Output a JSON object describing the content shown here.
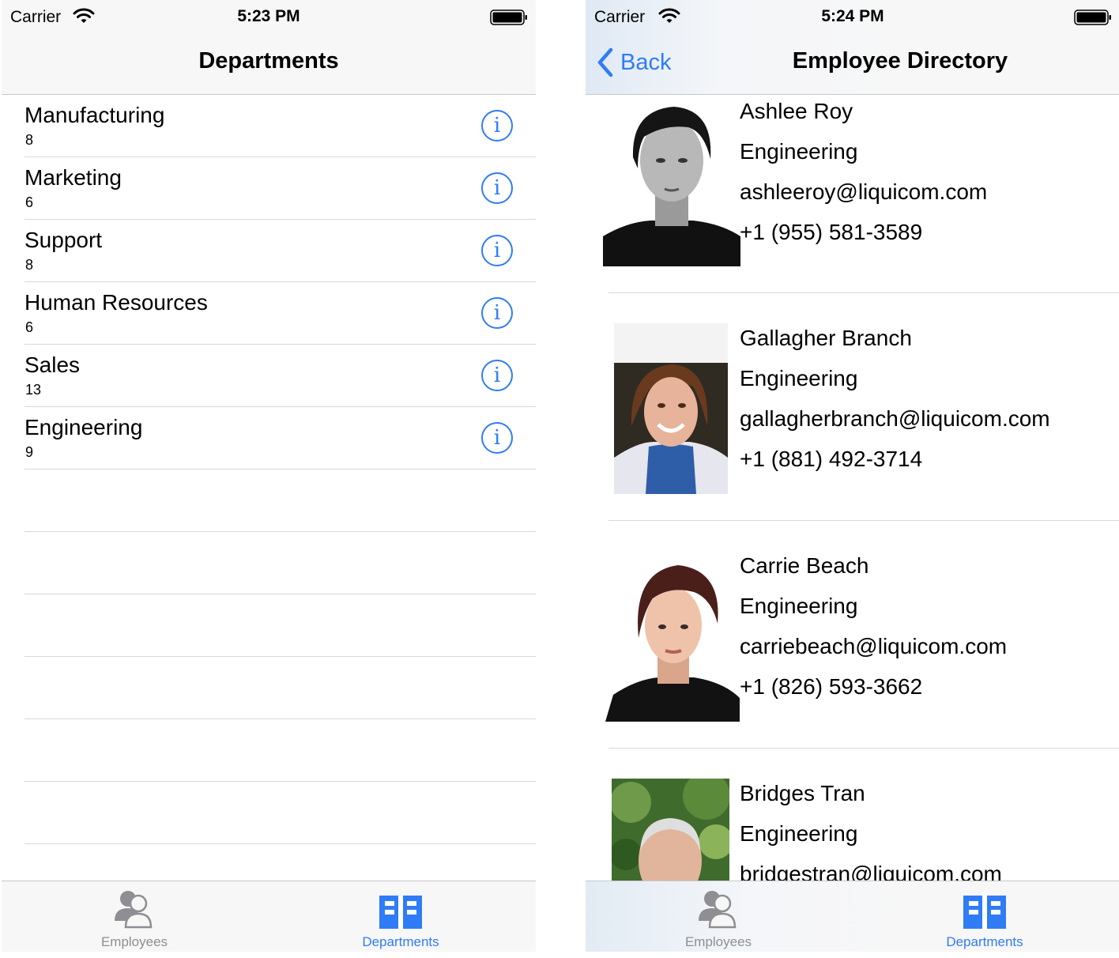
{
  "colors": {
    "accent": "#2f7cf6",
    "inactive": "#8e8e93",
    "separator": "#d8d8dc"
  },
  "left_screen": {
    "status": {
      "carrier": "Carrier",
      "time": "5:23 PM"
    },
    "nav_title": "Departments",
    "departments": [
      {
        "name": "Manufacturing",
        "count": "8",
        "info_icon": "info-icon"
      },
      {
        "name": "Marketing",
        "count": "6",
        "info_icon": "info-icon"
      },
      {
        "name": "Support",
        "count": "8",
        "info_icon": "info-icon"
      },
      {
        "name": "Human Resources",
        "count": "6",
        "info_icon": "info-icon"
      },
      {
        "name": "Sales",
        "count": "13",
        "info_icon": "info-icon"
      },
      {
        "name": "Engineering",
        "count": "9",
        "info_icon": "info-icon"
      }
    ],
    "tabs": [
      {
        "label": "Employees",
        "icon": "people-icon",
        "selected": false
      },
      {
        "label": "Departments",
        "icon": "building-icon",
        "selected": true
      }
    ]
  },
  "right_screen": {
    "status": {
      "carrier": "Carrier",
      "time": "5:24 PM"
    },
    "back_label": "Back",
    "nav_title": "Employee Directory",
    "employees": [
      {
        "name": "Ashlee Roy",
        "department": "Engineering",
        "email": "ashleeroy@liquicom.com",
        "phone": "+1 (955) 581-3589"
      },
      {
        "name": "Gallagher Branch",
        "department": "Engineering",
        "email": "gallagherbranch@liquicom.com",
        "phone": "+1 (881) 492-3714"
      },
      {
        "name": "Carrie Beach",
        "department": "Engineering",
        "email": "carriebeach@liquicom.com",
        "phone": "+1 (826) 593-3662"
      },
      {
        "name": "Bridges Tran",
        "department": "Engineering",
        "email": "bridgestran@liquicom.com",
        "phone": ""
      }
    ],
    "tabs": [
      {
        "label": "Employees",
        "icon": "people-icon",
        "selected": false
      },
      {
        "label": "Departments",
        "icon": "building-icon",
        "selected": true
      }
    ]
  }
}
